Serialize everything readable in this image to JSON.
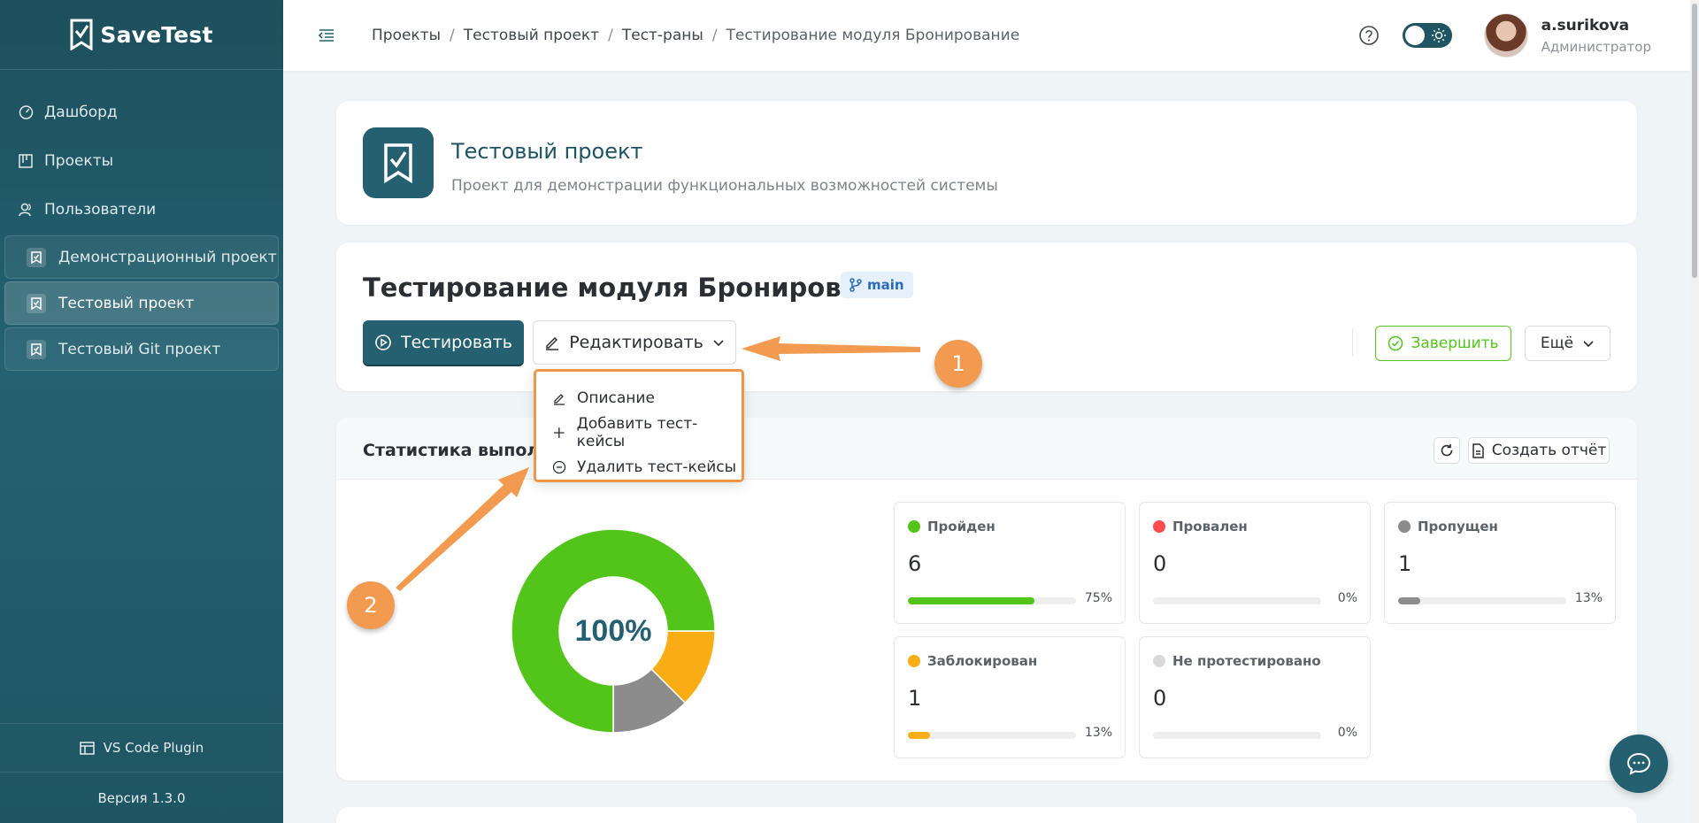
{
  "app": {
    "name": "SaveTest"
  },
  "sidebar": {
    "nav": [
      {
        "label": "Дашборд",
        "icon": "dashboard-icon"
      },
      {
        "label": "Проекты",
        "icon": "projects-icon"
      },
      {
        "label": "Пользователи",
        "icon": "users-icon"
      }
    ],
    "projects": [
      {
        "label": "Демонстрационный проект",
        "active": false
      },
      {
        "label": "Тестовый проект",
        "active": true
      },
      {
        "label": "Тестовый Git проект",
        "active": false
      }
    ],
    "plugin_label": "VS Code Plugin",
    "version": "Версия 1.3.0"
  },
  "header": {
    "breadcrumb": [
      "Проекты",
      "Тестовый проект",
      "Тест-раны",
      "Тестирование модуля Бронирование"
    ],
    "user": {
      "name": "a.surikova",
      "role": "Администратор"
    }
  },
  "project": {
    "title": "Тестовый проект",
    "description": "Проект для демонстрации функциональных возможностей системы"
  },
  "run": {
    "title": "Тестирование модуля Бронирование",
    "branch": "main",
    "test_button": "Тестировать",
    "edit_button": "Редактировать",
    "finish_button": "Завершить",
    "more_button": "Ещё"
  },
  "edit_menu": [
    {
      "label": "Описание",
      "icon": "pencil-icon"
    },
    {
      "label": "Добавить тест-кейсы",
      "icon": "plus-icon"
    },
    {
      "label": "Удалить тест-кейсы",
      "icon": "minus-circle-icon"
    }
  ],
  "stats": {
    "title": "Статистика выполне",
    "report_button": "Создать отчёт",
    "donut_center": "100%",
    "items": [
      {
        "label": "Пройден",
        "count": "6",
        "percent": "75%",
        "fraction": 0.75,
        "color": "#52c41a"
      },
      {
        "label": "Провален",
        "count": "0",
        "percent": "0%",
        "fraction": 0,
        "color": "#ff4d4f"
      },
      {
        "label": "Пропущен",
        "count": "1",
        "percent": "13%",
        "fraction": 0.13,
        "color": "#8c8c8c"
      },
      {
        "label": "Заблокирован",
        "count": "1",
        "percent": "13%",
        "fraction": 0.13,
        "color": "#faad14"
      },
      {
        "label": "Не протестировано",
        "count": "0",
        "percent": "0%",
        "fraction": 0,
        "color": "#d9d9d9"
      }
    ]
  },
  "chart_data": {
    "type": "pie",
    "categories": [
      "Пройден",
      "Заблокирован",
      "Пропущен"
    ],
    "values": [
      6,
      1,
      1
    ],
    "title": "100%"
  },
  "annotations": [
    "1",
    "2"
  ],
  "colors": {
    "primary": "#24606f",
    "accent": "#f0954c"
  }
}
